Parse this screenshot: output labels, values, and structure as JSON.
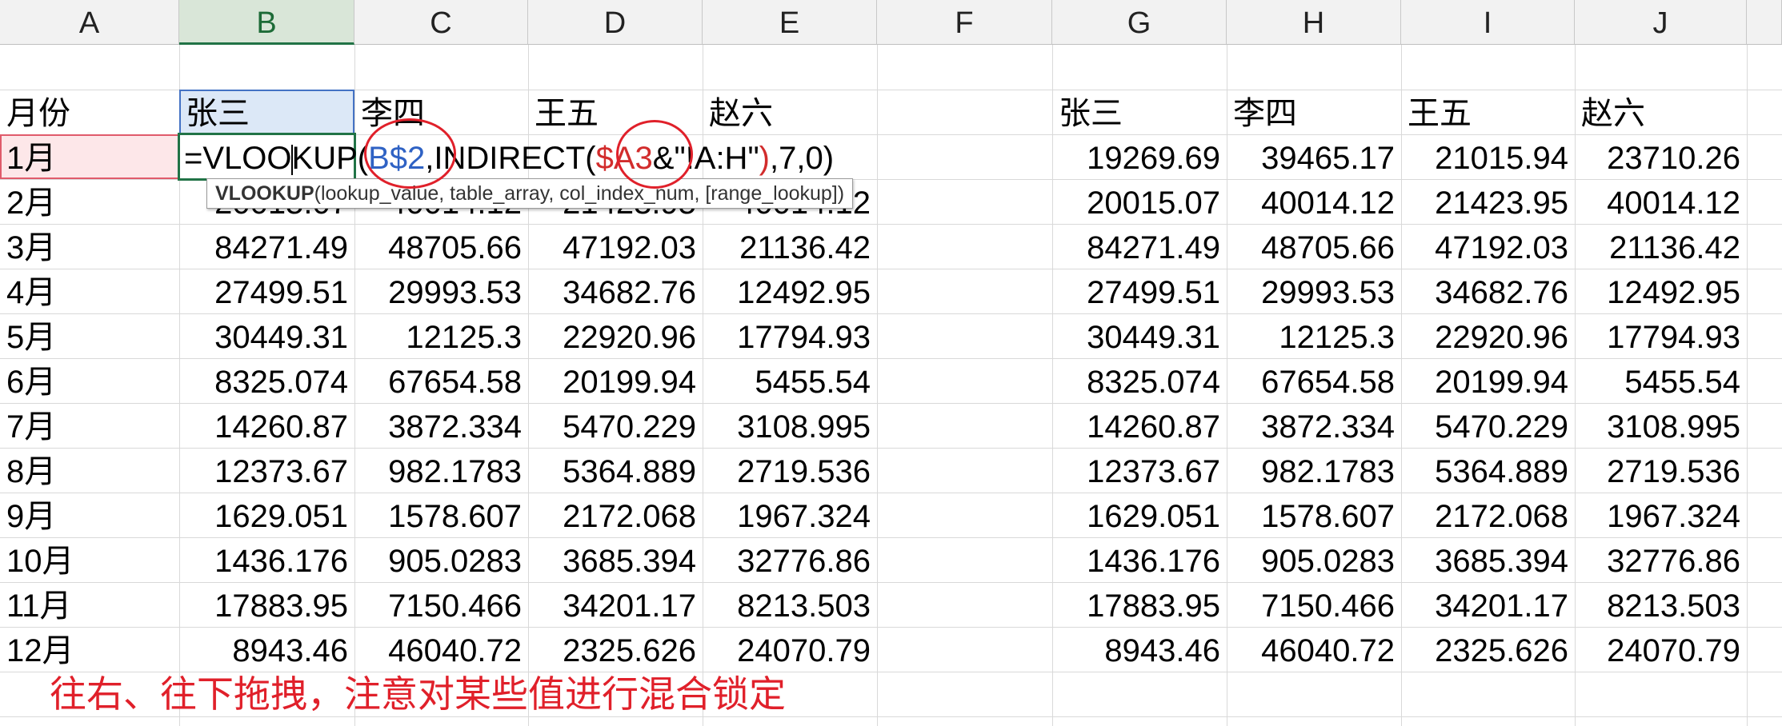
{
  "columns": [
    "A",
    "B",
    "C",
    "D",
    "E",
    "F",
    "G",
    "H",
    "I",
    "J"
  ],
  "left_header": {
    "label": "月份",
    "names": [
      "张三",
      "李四",
      "王五",
      "赵六"
    ]
  },
  "right_header": {
    "names": [
      "张三",
      "李四",
      "王五",
      "赵六"
    ]
  },
  "months": [
    "1月",
    "2月",
    "3月",
    "4月",
    "5月",
    "6月",
    "7月",
    "8月",
    "9月",
    "10月",
    "11月",
    "12月"
  ],
  "left_rows": [
    [
      "",
      "",
      "",
      ""
    ],
    [
      "20015.07",
      "40014.12",
      "21423.95",
      "40014.12"
    ],
    [
      "84271.49",
      "48705.66",
      "47192.03",
      "21136.42"
    ],
    [
      "27499.51",
      "29993.53",
      "34682.76",
      "12492.95"
    ],
    [
      "30449.31",
      "12125.3",
      "22920.96",
      "17794.93"
    ],
    [
      "8325.074",
      "67654.58",
      "20199.94",
      "5455.54"
    ],
    [
      "14260.87",
      "3872.334",
      "5470.229",
      "3108.995"
    ],
    [
      "12373.67",
      "982.1783",
      "5364.889",
      "2719.536"
    ],
    [
      "1629.051",
      "1578.607",
      "2172.068",
      "1967.324"
    ],
    [
      "1436.176",
      "905.0283",
      "3685.394",
      "32776.86"
    ],
    [
      "17883.95",
      "7150.466",
      "34201.17",
      "8213.503"
    ],
    [
      "8943.46",
      "46040.72",
      "2325.626",
      "24070.79"
    ]
  ],
  "right_rows": [
    [
      "19269.69",
      "39465.17",
      "21015.94",
      "23710.26"
    ],
    [
      "20015.07",
      "40014.12",
      "21423.95",
      "40014.12"
    ],
    [
      "84271.49",
      "48705.66",
      "47192.03",
      "21136.42"
    ],
    [
      "27499.51",
      "29993.53",
      "34682.76",
      "12492.95"
    ],
    [
      "30449.31",
      "12125.3",
      "22920.96",
      "17794.93"
    ],
    [
      "8325.074",
      "67654.58",
      "20199.94",
      "5455.54"
    ],
    [
      "14260.87",
      "3872.334",
      "5470.229",
      "3108.995"
    ],
    [
      "12373.67",
      "982.1783",
      "5364.889",
      "2719.536"
    ],
    [
      "1629.051",
      "1578.607",
      "2172.068",
      "1967.324"
    ],
    [
      "1436.176",
      "905.0283",
      "3685.394",
      "32776.86"
    ],
    [
      "17883.95",
      "7150.466",
      "34201.17",
      "8213.503"
    ],
    [
      "8943.46",
      "46040.72",
      "2325.626",
      "24070.79"
    ]
  ],
  "formula": {
    "prefix": "=VLOO",
    "mid": "KUP(",
    "ref1": "B$2",
    "part2": ",INDIRECT(",
    "ref2": "$A3",
    "part3": "&\"!A:H\"",
    "close": ")",
    "suffix": ",7,0)"
  },
  "tooltip": {
    "func": "VLOOKUP",
    "args": "(lookup_value, table_array, col_index_num, [range_lookup])"
  },
  "annotation": "往右、往下拖拽，注意对某些值进行混合锁定",
  "colors": {
    "header_bg": "#f2f2f2",
    "active_header": "#217346",
    "ref_blue": "#2f62c4",
    "ref_red": "#d22c2c",
    "annotation_red": "#e0202a"
  }
}
